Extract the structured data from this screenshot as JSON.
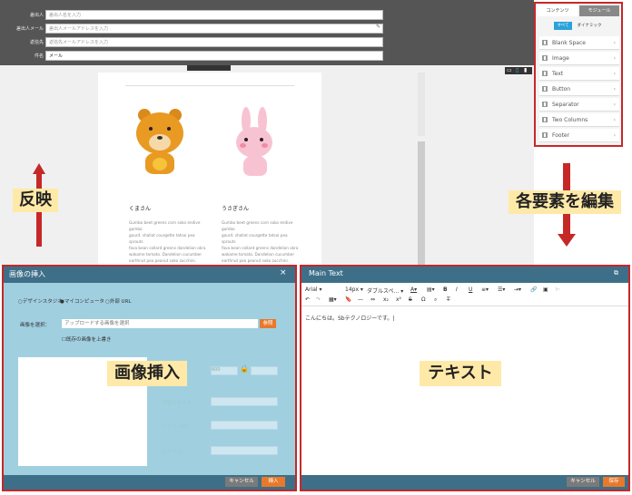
{
  "header_form": {
    "rows": [
      {
        "label": "差出人",
        "placeholder": "差出人名を入力"
      },
      {
        "label": "差出人メール",
        "placeholder": "差出人メールアドレスを入力"
      },
      {
        "label": "返信先",
        "placeholder": "返信先メールアドレスを入力"
      },
      {
        "label": "件名",
        "value": "メール"
      }
    ]
  },
  "right_panel": {
    "tabs": [
      "コンテンツ",
      "モジュール"
    ],
    "subtabs": [
      "すべて",
      "ダイナミック"
    ],
    "items": [
      "Blank Space",
      "Image",
      "Text",
      "Button",
      "Separator",
      "Two Columns",
      "Footer"
    ]
  },
  "preview": {
    "animals": [
      {
        "name": "くまさん",
        "text": "Gumbo beet greens corn soko endive gumbo\ngourd. shallot courgette tatsoi pea sprouts\nfava bean collard greens dandelion okra\nwakame tomato. Dandelion cucumber\nearthnut pea peanut soko zucchini."
      },
      {
        "name": "うさぎさん",
        "text": "Gumbo beet greens corn soko endive gumbo\ngourd. shallot courgette tatsoi pea sprouts\nfava bean collard greens dandelion okra\nwakame tomato. Dandelion cucumber\nearthnut pea peanut soko zucchini."
      }
    ]
  },
  "annotations": {
    "reflect": "反映",
    "edit_elements": "各要素を編集",
    "image_insert": "画像挿入",
    "text": "テキスト"
  },
  "image_dialog": {
    "title": "画像の挿入",
    "close": "×",
    "radio_options": [
      "デザインスタジオ",
      "マイコンピュータ",
      "外部 URL"
    ],
    "select_label": "画像を選択：",
    "upload_placeholder": "アップロードする画像を選択",
    "browse": "参照",
    "overwrite_checkbox": "既存の画像を上書き",
    "field_labels": [
      "代替テキスト",
      "リンク URL：",
      "スタイル"
    ],
    "size_value": "600",
    "cancel": "キャンセル",
    "insert": "挿入"
  },
  "text_dialog": {
    "title": "Main Text",
    "font": "Arial",
    "size": "14px",
    "style": "ダブルスペ...",
    "body": "こんにちは。Sbテクノロジーです。",
    "cancel": "キャンセル",
    "save": "保存"
  },
  "colors": {
    "annotation_red": "#c62828",
    "annotation_yellow": "#ffe9a8",
    "dialog_header": "#3d6f88",
    "accent_orange": "#e8792b"
  }
}
